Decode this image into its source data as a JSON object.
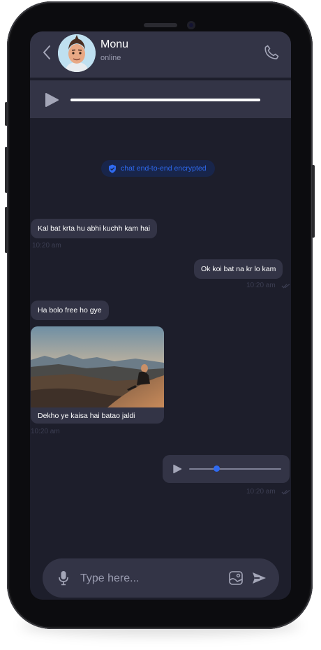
{
  "contact": {
    "name": "Monu",
    "status": "online"
  },
  "encryption_notice": "chat end-to-end encrypted",
  "messages": [
    {
      "text": "Kal bat krta hu abhi kuchh kam hai",
      "time": "10:20 am"
    },
    {
      "text": "Ok koi bat na kr lo kam",
      "time": "10:20 am"
    },
    {
      "text": "Ha bolo free ho gye"
    },
    {
      "caption": "Dekho ye kaisa hai batao jaldi",
      "time": "10:20 am"
    },
    {
      "time": "10:20 am"
    }
  ],
  "composer": {
    "placeholder": "Type here..."
  },
  "voice_note": {
    "progress": 0.3
  },
  "colors": {
    "accent": "#2f6af0",
    "bubble": "#333446",
    "background": "#1d1e2b"
  },
  "icons": {
    "back": "chevron-left-icon",
    "call": "phone-icon",
    "play": "play-icon",
    "shield": "shield-check-icon",
    "read": "double-check-icon",
    "mic": "microphone-icon",
    "gallery": "gallery-icon",
    "send": "send-icon"
  }
}
